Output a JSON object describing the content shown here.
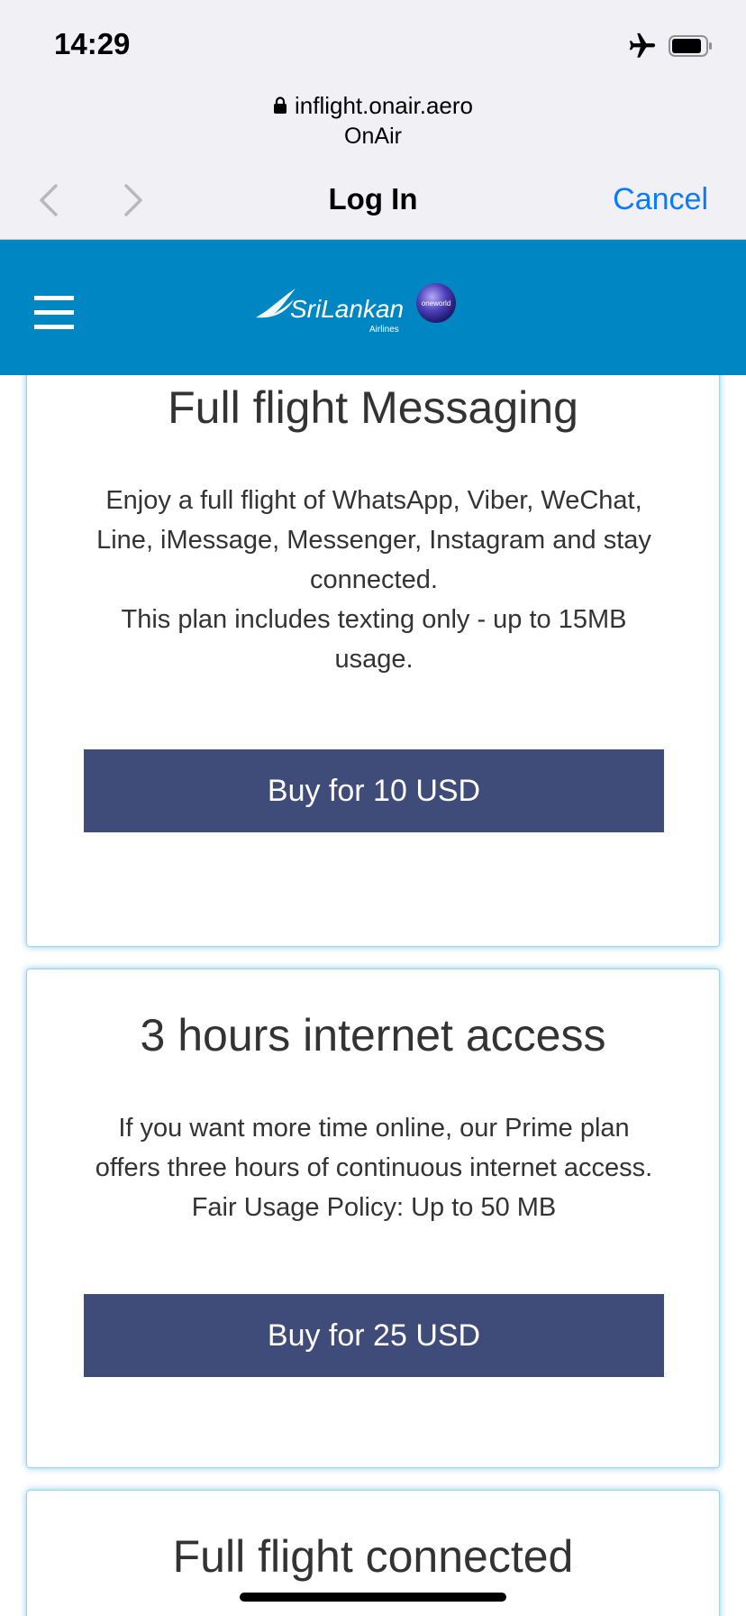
{
  "status_bar": {
    "time": "14:29"
  },
  "browser": {
    "url": "inflight.onair.aero",
    "site_name": "OnAir",
    "page_title": "Log In",
    "cancel_label": "Cancel"
  },
  "header": {
    "logo_text": "SriLankan",
    "logo_subtext": "Airlines",
    "alliance_text": "oneworld",
    "brand_color": "#0086c3"
  },
  "plans": [
    {
      "title": "Full flight Messaging",
      "description_lines": [
        "Enjoy a full flight of WhatsApp, Viber, WeChat,",
        "Line, iMessage, Messenger, Instagram and stay",
        "connected.",
        "This plan includes texting only - up to 15MB",
        "usage."
      ],
      "button_label": "Buy for 10 USD"
    },
    {
      "title": "3 hours internet access",
      "description_lines": [
        "If you want more time online, our Prime plan",
        "offers three hours of continuous internet access.",
        "Fair Usage Policy: Up to 50 MB"
      ],
      "button_label": "Buy for 25 USD"
    },
    {
      "title": "Full flight connected"
    }
  ],
  "colors": {
    "accent_link": "#0a7aff",
    "button_bg": "#3f4c7a"
  },
  "icons": [
    "lock-icon",
    "airplane-icon",
    "battery-icon",
    "back-chevron-icon",
    "forward-chevron-icon",
    "menu-icon"
  ]
}
